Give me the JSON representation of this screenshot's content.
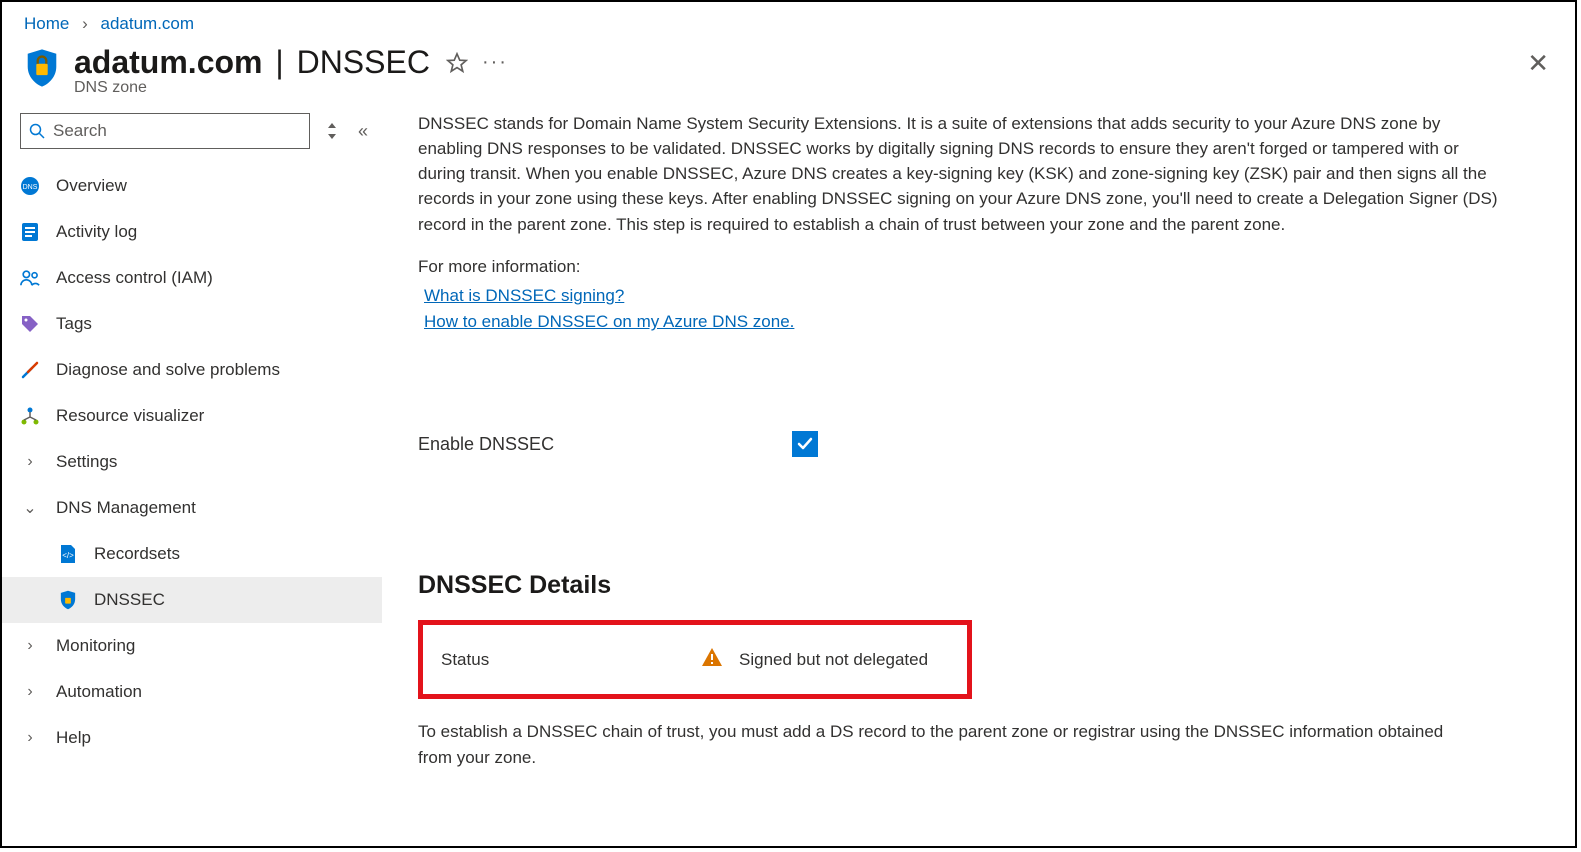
{
  "breadcrumb": {
    "home": "Home",
    "zone": "adatum.com"
  },
  "header": {
    "title": "adatum.com",
    "section": "DNSSEC",
    "subtitle": "DNS zone"
  },
  "search": {
    "placeholder": "Search"
  },
  "nav": {
    "overview": "Overview",
    "activity": "Activity log",
    "iam": "Access control (IAM)",
    "tags": "Tags",
    "diagnose": "Diagnose and solve problems",
    "resvis": "Resource visualizer",
    "settings": "Settings",
    "dnsmgmt": "DNS Management",
    "recordsets": "Recordsets",
    "dnssec": "DNSSEC",
    "monitoring": "Monitoring",
    "automation": "Automation",
    "help": "Help"
  },
  "content": {
    "description": "DNSSEC stands for Domain Name System Security Extensions. It is a suite of extensions that adds security to your Azure DNS zone by enabling DNS responses to be validated. DNSSEC works by digitally signing DNS records to ensure they aren't forged or tampered with or during transit. When you enable DNSSEC, Azure DNS creates a key-signing key (KSK) and zone-signing key (ZSK) pair and then signs all the records in your zone using these keys. After enabling DNSSEC signing on your Azure DNS zone, you'll need to create a Delegation Signer (DS) record in the parent zone. This step is required to establish a chain of trust between your zone and the parent zone.",
    "moreinfo": "For more information:",
    "link1": "What is DNSSEC signing?",
    "link2": "How to enable DNSSEC on my Azure DNS zone.",
    "enable_label": "Enable DNSSEC",
    "details_header": "DNSSEC Details",
    "status_label": "Status",
    "status_value": "Signed but not delegated",
    "footer": "To establish a DNSSEC chain of trust, you must add a DS record to the parent zone or registrar using the DNSSEC information obtained from your zone."
  }
}
